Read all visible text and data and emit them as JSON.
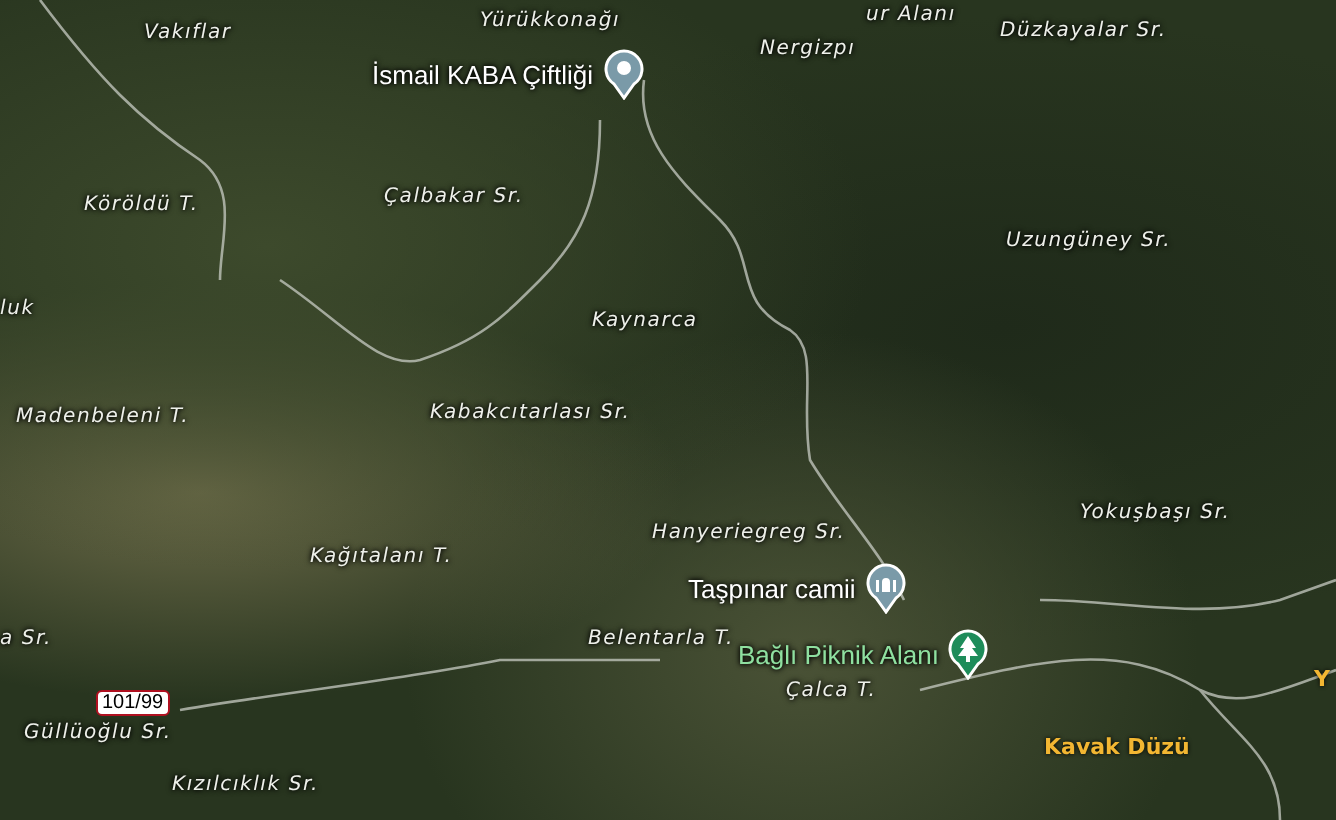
{
  "map": {
    "labels": [
      {
        "kind": "area",
        "text": "Vakıflar"
      },
      {
        "kind": "area",
        "text": "Yürükkonağı"
      },
      {
        "kind": "area",
        "text": "ur Alanı"
      },
      {
        "kind": "area",
        "text": "Nergizpı"
      },
      {
        "kind": "area",
        "text": "Düzkayalar Sr."
      },
      {
        "kind": "area",
        "text": "Köröldü T."
      },
      {
        "kind": "area",
        "text": "Çalbakar Sr."
      },
      {
        "kind": "area",
        "text": "Uzungüney Sr."
      },
      {
        "kind": "area",
        "text": "luk"
      },
      {
        "kind": "area",
        "text": "Kaynarca"
      },
      {
        "kind": "area",
        "text": "Madenbeleni T."
      },
      {
        "kind": "area",
        "text": "Kabakcıtarlası Sr."
      },
      {
        "kind": "area",
        "text": "Hanyeriegreg Sr."
      },
      {
        "kind": "area",
        "text": "Yokuşbaşı Sr."
      },
      {
        "kind": "area",
        "text": "Kağıtalanı T."
      },
      {
        "kind": "area",
        "text": "a Sr."
      },
      {
        "kind": "area",
        "text": "Belentarla T."
      },
      {
        "kind": "area",
        "text": "Çalca T."
      },
      {
        "kind": "area",
        "text": "Güllüoğlu Sr."
      },
      {
        "kind": "area",
        "text": "Kızılcıklık Sr."
      },
      {
        "kind": "locality",
        "text": "Kavak Düzü"
      },
      {
        "kind": "locality",
        "text": "Y"
      },
      {
        "kind": "shield",
        "text": "101/99"
      }
    ],
    "places": [
      {
        "kind": "pin",
        "text": "İsmail KABA Çiftliği"
      },
      {
        "kind": "mosque",
        "text": "Taşpınar camii"
      },
      {
        "kind": "park",
        "text": "Bağlı Piknik Alanı"
      }
    ]
  }
}
